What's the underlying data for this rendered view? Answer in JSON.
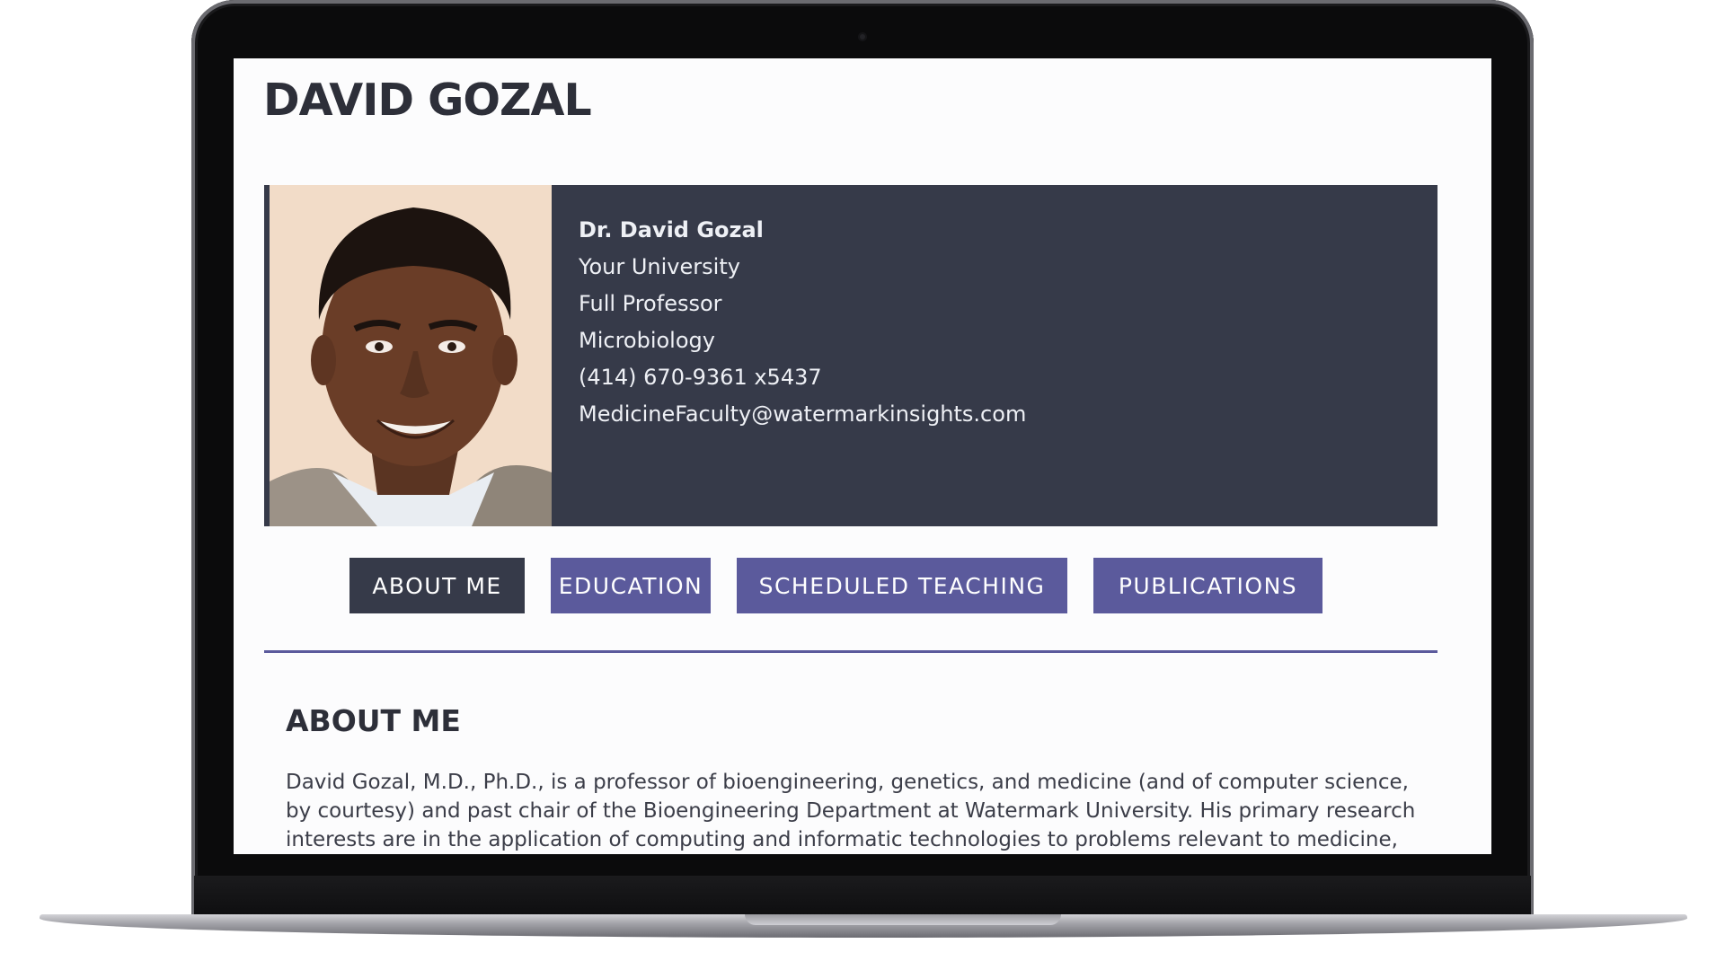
{
  "page": {
    "title": "DAVID GOZAL"
  },
  "profile": {
    "name": "Dr. David Gozal",
    "institution": "Your University",
    "position": "Full Professor",
    "department": "Microbiology",
    "phone": "(414) 670-9361 x5437",
    "email": "MedicineFaculty@watermarkinsights.com"
  },
  "tabs": [
    {
      "label": "ABOUT ME",
      "active": true
    },
    {
      "label": "EDUCATION",
      "active": false
    },
    {
      "label": "SCHEDULED TEACHING",
      "active": false
    },
    {
      "label": "PUBLICATIONS",
      "active": false
    }
  ],
  "about": {
    "heading": "ABOUT ME",
    "body": "David Gozal, M.D., Ph.D., is a professor of bioengineering, genetics, and medicine (and of computer science, by courtesy) and past chair of the Bioengineering Department at Watermark University. His primary research interests are in the application of computing and informatic technologies to problems relevant to medicine,"
  },
  "colors": {
    "dark_navy": "#363a49",
    "purple": "#5b5a9c",
    "title_text": "#2d2f39"
  },
  "icons": {
    "profile_photo": "avatar-photo"
  }
}
